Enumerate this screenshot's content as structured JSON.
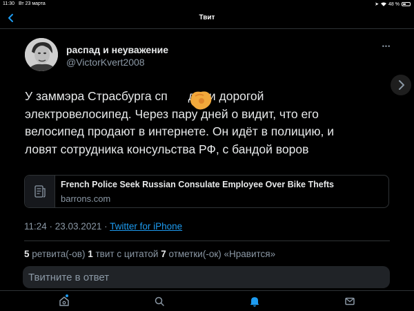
{
  "status_bar": {
    "time": "11:30",
    "date": "Вт 23 марта",
    "battery": "48 %",
    "battery_level": 0.48
  },
  "nav": {
    "title": "Твит",
    "back_icon": "chevron-left-icon"
  },
  "tweet": {
    "author_name": "распад и неуважение",
    "author_handle": "@VictorKvert2008",
    "more_icon": "more-dots-icon",
    "text_lines": [
      "У заммэра Страсбурга сп",
      "дили дорогой",
      "электровелосипед. Через пару дней о видит, что его",
      "велосипед продают в интернете. Он идёт в полицию, и",
      "ловят сотрудника консульства РФ, с бандой воров"
    ],
    "link_card": {
      "title": "French Police Seek Russian Consulate Employee Over Bike Thefts",
      "domain": "barrons.com",
      "icon": "article-icon"
    },
    "timestamp": "11:24 · 23.03.2021 ·",
    "source": "Twitter for iPhone",
    "stats": {
      "retweets_count": "5",
      "retweets_label": "ретвита(-ов)",
      "quotes_count": "1",
      "quotes_label": "твит с цитатой",
      "likes_count": "7",
      "likes_label": "отметки(-ок) «Нравится»"
    }
  },
  "reply": {
    "placeholder": "Твитните в ответ"
  },
  "tab_bar": {
    "items": [
      "home-icon",
      "search-icon",
      "notifications-icon",
      "messages-icon"
    ]
  },
  "colors": {
    "background": "#000000",
    "text": "#e7e9ea",
    "secondary_text": "#8b98a5",
    "accent": "#1d9bf0",
    "border": "#2f3336"
  }
}
